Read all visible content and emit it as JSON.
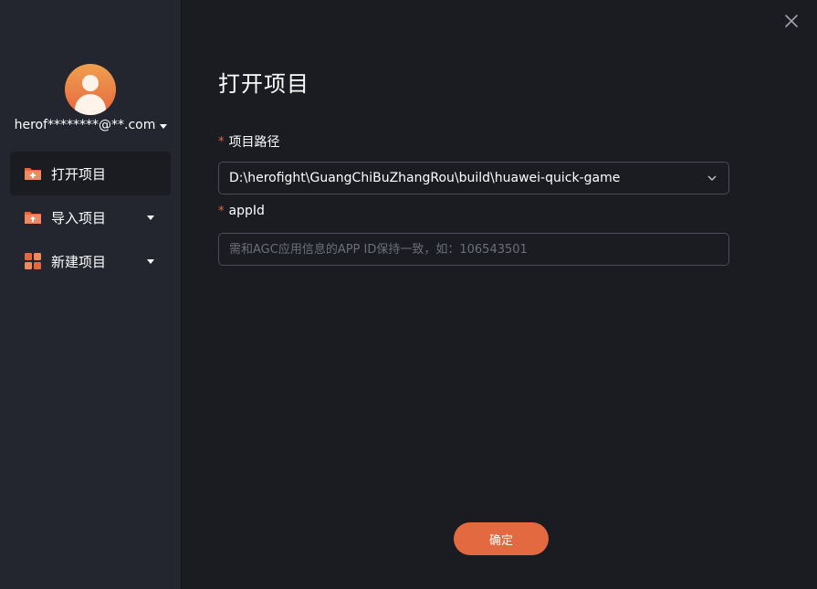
{
  "account": {
    "email": "herof********@**.com"
  },
  "sidebar": {
    "items": [
      {
        "label": "打开项目",
        "icon": "folder-plus-icon",
        "active": true
      },
      {
        "label": "导入项目",
        "icon": "folder-upload-icon",
        "active": false
      },
      {
        "label": "新建项目",
        "icon": "grid-plus-icon",
        "active": false
      }
    ]
  },
  "main": {
    "title": "打开项目",
    "path_field": {
      "label": "项目路径",
      "required_mark": "*",
      "value": "D:\\herofight\\GuangChiBuZhangRou\\build\\huawei-quick-game"
    },
    "appid_field": {
      "label": "appId",
      "required_mark": "*",
      "value": "",
      "placeholder": "需和AGC应用信息的APP ID保持一致，如：106543501"
    },
    "confirm_label": "确定"
  },
  "colors": {
    "accent": "#e36a40",
    "background": "#1a1c22",
    "sidebar": "#23262f"
  }
}
